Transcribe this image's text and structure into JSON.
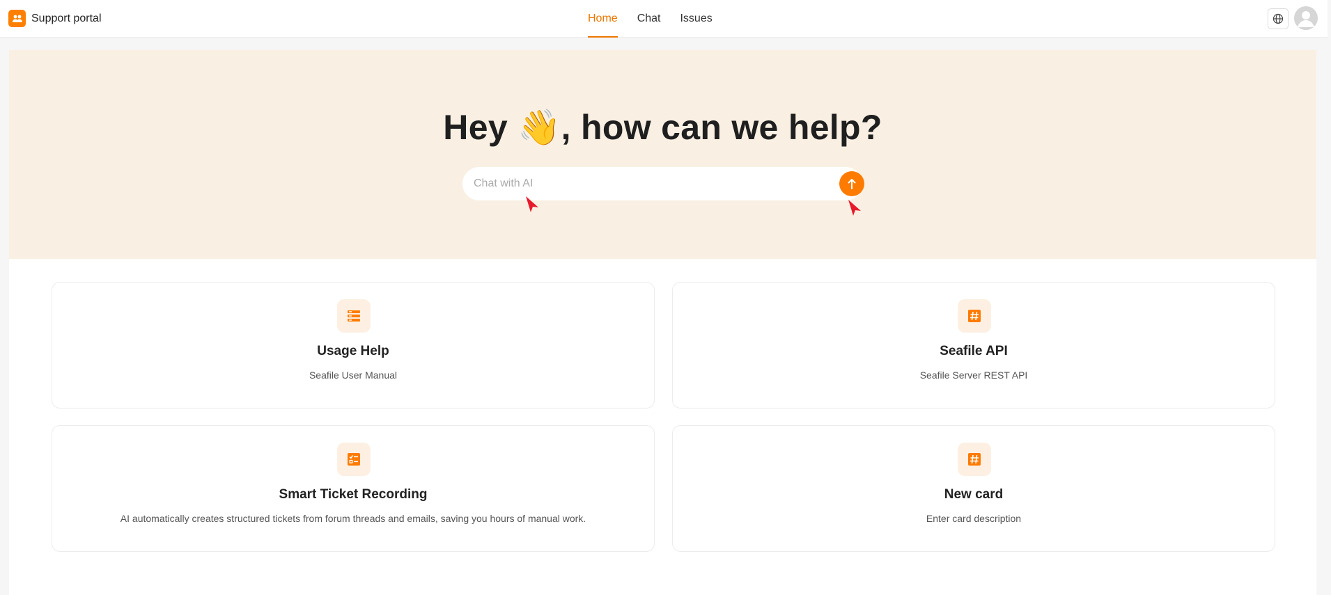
{
  "header": {
    "brand": "Support portal",
    "tabs": [
      {
        "label": "Home",
        "active": true
      },
      {
        "label": "Chat",
        "active": false
      },
      {
        "label": "Issues",
        "active": false
      }
    ],
    "language_icon": "globe-icon",
    "avatar_icon": "user-avatar-icon"
  },
  "hero": {
    "title": "Hey 👋, how can we help?",
    "search_placeholder": "Chat with AI",
    "send_icon": "arrow-up-icon"
  },
  "cards": [
    {
      "title": "Usage Help",
      "description": "Seafile User Manual",
      "icon": "list-icon"
    },
    {
      "title": "Seafile API",
      "description": "Seafile Server REST API",
      "icon": "hash-icon"
    },
    {
      "title": "Smart Ticket Recording",
      "description": "AI automatically creates structured tickets from forum threads and emails, saving you hours of manual work.",
      "icon": "checklist-icon"
    },
    {
      "title": "New card",
      "description": "Enter card description",
      "icon": "hash-icon"
    }
  ],
  "colors": {
    "accent": "#ff7b00",
    "hero_bg": "#f9f0e3",
    "icon_bg": "#fdf0e3"
  }
}
